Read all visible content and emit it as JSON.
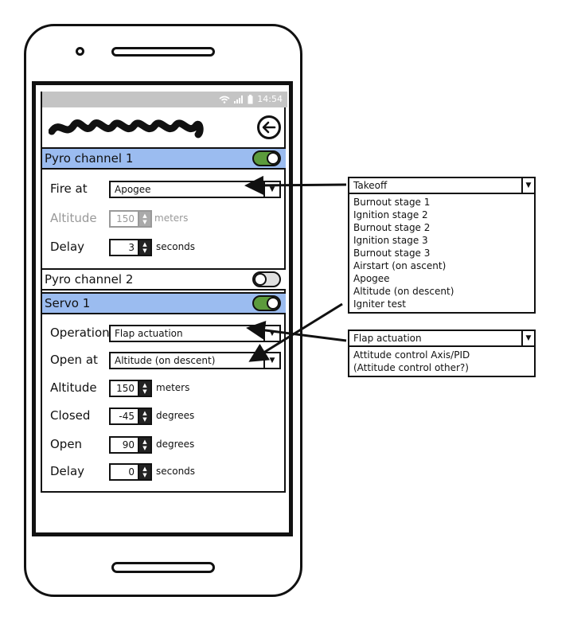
{
  "status": {
    "time": "14:54"
  },
  "header": {
    "back_icon": "back-arrow-icon"
  },
  "pyro1": {
    "label": "Pyro channel 1",
    "enabled": true,
    "fire_at_label": "Fire at",
    "fire_at_value": "Apogee",
    "altitude_label": "Altitude",
    "altitude_value": "150",
    "altitude_unit": "meters",
    "delay_label": "Delay",
    "delay_value": "3",
    "delay_unit": "seconds"
  },
  "pyro2": {
    "label": "Pyro channel 2",
    "enabled": false
  },
  "servo1": {
    "label": "Servo 1",
    "enabled": true,
    "operation_label": "Operation",
    "operation_value": "Flap actuation",
    "open_at_label": "Open at",
    "open_at_value": "Altitude (on descent)",
    "altitude_label": "Altitude",
    "altitude_value": "150",
    "altitude_unit": "meters",
    "closed_label": "Closed",
    "closed_value": "-45",
    "closed_unit": "degrees",
    "open_label": "Open",
    "open_value": "90",
    "open_unit": "degrees",
    "delay_label": "Delay",
    "delay_value": "0",
    "delay_unit": "seconds"
  },
  "event_dropdown": {
    "selected": "Takeoff",
    "options": [
      "Burnout stage 1",
      "Ignition stage 2",
      "Burnout stage 2",
      "Ignition stage 3",
      "Burnout stage 3",
      "Airstart (on ascent)",
      "Apogee",
      "Altitude (on descent)",
      "Igniter test"
    ]
  },
  "operation_dropdown": {
    "selected": "Flap actuation",
    "options": [
      "Attitude control Axis/PID",
      "(Attitude control other?)"
    ]
  },
  "colors": {
    "header_blue": "#9bbcf0",
    "toggle_green": "#5c9b3c"
  }
}
